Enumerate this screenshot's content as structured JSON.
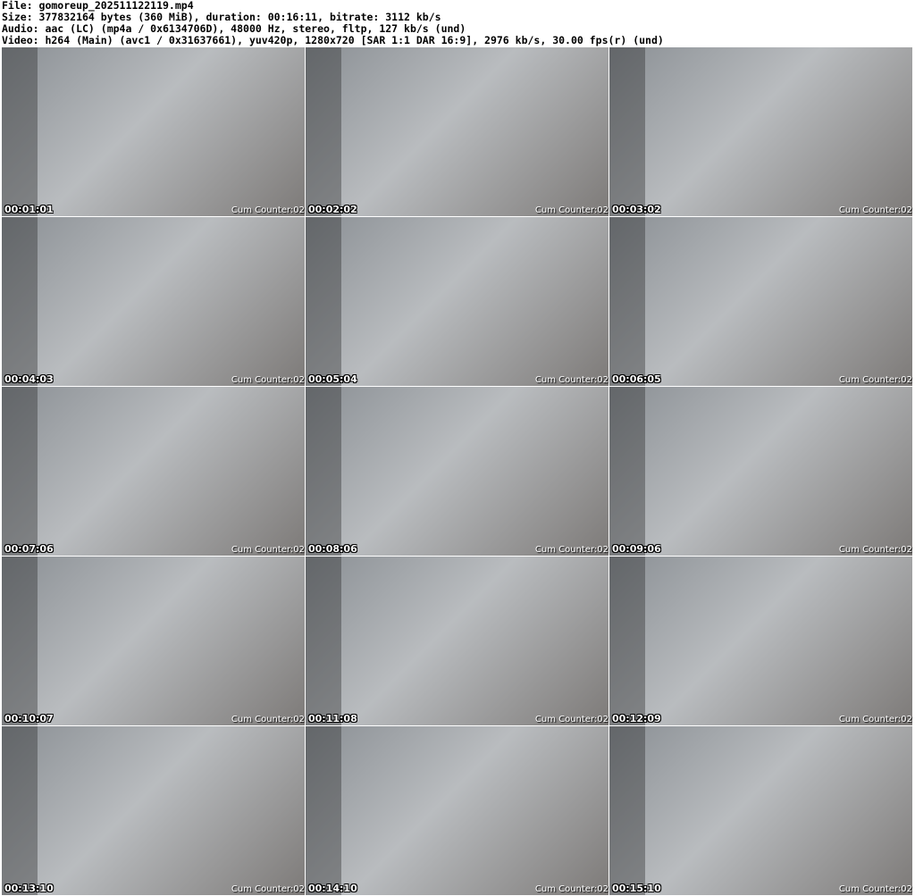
{
  "header": {
    "file": "File: gomoreup_202511122119.mp4",
    "size": "Size: 377832164 bytes (360 MiB), duration: 00:16:11, bitrate: 3112 kb/s",
    "audio": "Audio: aac (LC) (mp4a / 0x6134706D), 48000 Hz, stereo, fltp, 127 kb/s (und)",
    "video": "Video: h264 (Main) (avc1 / 0x31637661), yuv420p, 1280x720 [SAR 1:1 DAR 16:9], 2976 kb/s, 30.00 fps(r) (und)"
  },
  "overlay_label": "Cum Counter:02",
  "thumbnails": [
    {
      "timestamp": "00:01:01"
    },
    {
      "timestamp": "00:02:02"
    },
    {
      "timestamp": "00:03:02"
    },
    {
      "timestamp": "00:04:03"
    },
    {
      "timestamp": "00:05:04"
    },
    {
      "timestamp": "00:06:05"
    },
    {
      "timestamp": "00:07:06"
    },
    {
      "timestamp": "00:08:06"
    },
    {
      "timestamp": "00:09:06"
    },
    {
      "timestamp": "00:10:07"
    },
    {
      "timestamp": "00:11:08"
    },
    {
      "timestamp": "00:12:09"
    },
    {
      "timestamp": "00:13:10"
    },
    {
      "timestamp": "00:14:10"
    },
    {
      "timestamp": "00:15:10"
    }
  ]
}
